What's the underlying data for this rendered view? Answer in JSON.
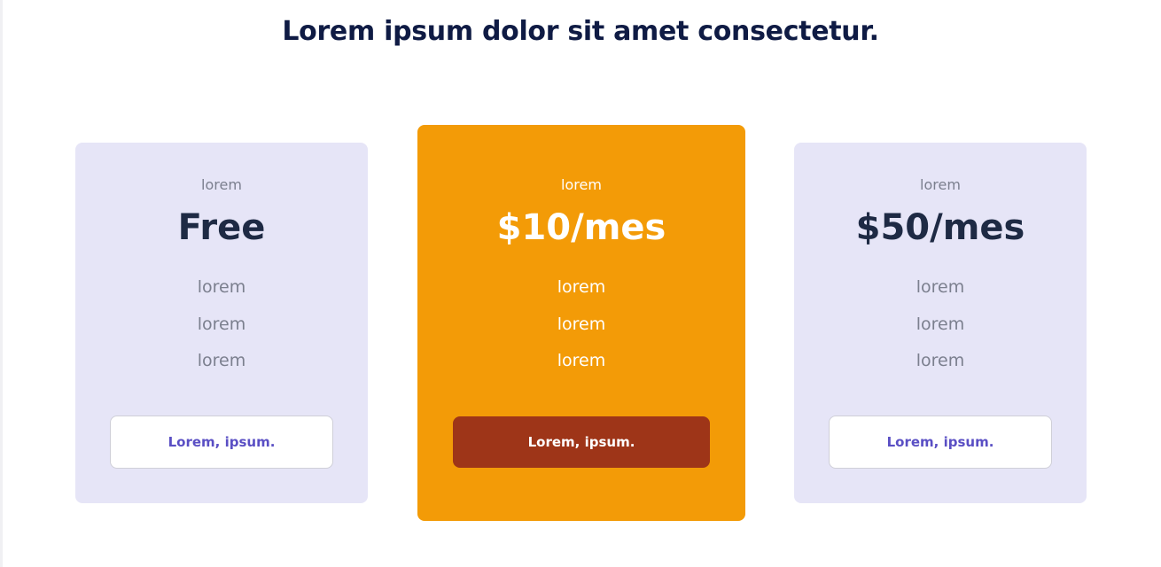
{
  "heading": "Lorem ipsum dolor sit amet consectetur.",
  "plans": [
    {
      "label": "lorem",
      "price": "Free",
      "features": [
        "lorem",
        "lorem",
        "lorem"
      ],
      "cta": "Lorem, ipsum."
    },
    {
      "label": "lorem",
      "price": "$10/mes",
      "features": [
        "lorem",
        "lorem",
        "lorem"
      ],
      "cta": "Lorem, ipsum."
    },
    {
      "label": "lorem",
      "price": "$50/mes",
      "features": [
        "lorem",
        "lorem",
        "lorem"
      ],
      "cta": "Lorem, ipsum."
    }
  ],
  "colors": {
    "card_background": "#e6e5f7",
    "featured_background": "#f39b07",
    "featured_button": "#9e3518",
    "button_text": "#5a4fc4",
    "heading": "#0f1b44"
  }
}
